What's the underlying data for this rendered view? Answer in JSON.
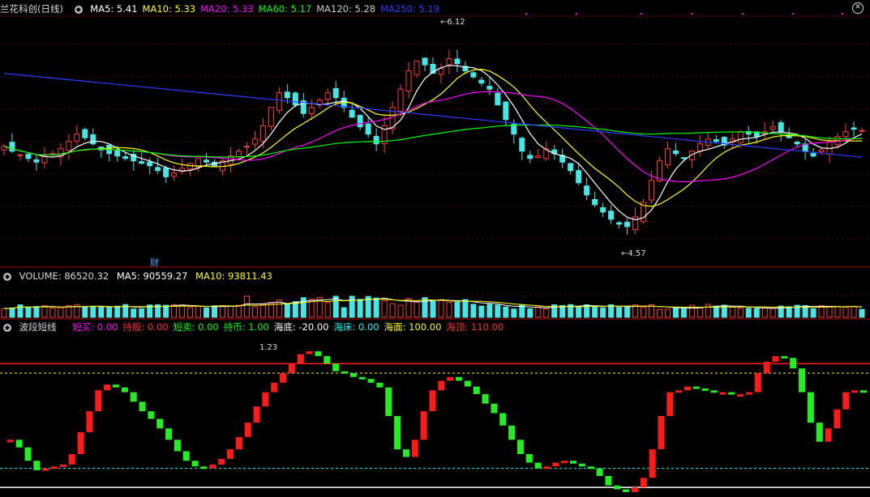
{
  "main_panel": {
    "title": "兰花科创(日线)",
    "ma": [
      {
        "label": "MA5: 5.41",
        "color": "#ffffff"
      },
      {
        "label": "MA10: 5.33",
        "color": "#ffff00"
      },
      {
        "label": "MA20: 5.33",
        "color": "#ff00ff"
      },
      {
        "label": "MA60: 5.17",
        "color": "#00ff00"
      },
      {
        "label": "MA120: 5.28",
        "color": "#cccccc"
      },
      {
        "label": "MA250: 5.19",
        "color": "#2a3cff"
      }
    ],
    "high_label": "6.12",
    "low_label": "4.57",
    "fin_mark": "财"
  },
  "volume_panel": {
    "title": "VOLUME: 86520.32",
    "ma5": "MA5: 90559.27",
    "ma10": "MA10: 93811.43"
  },
  "indicator_panel": {
    "title": "波段短线",
    "items": [
      {
        "label": "短买: 0.00",
        "color": "#ff00ff"
      },
      {
        "label": "持股: 0.00",
        "color": "#ff3030"
      },
      {
        "label": "短卖: 0.00",
        "color": "#00ff00"
      },
      {
        "label": "持币: 1.00",
        "color": "#00ff00"
      },
      {
        "label": "海底: -20.00",
        "color": "#ffffff"
      },
      {
        "label": "海床: 0.00",
        "color": "#00ffff"
      },
      {
        "label": "海面: 100.00",
        "color": "#ffff00"
      },
      {
        "label": "海顶: 110.00",
        "color": "#ff3030"
      }
    ],
    "peak_label": "1.23"
  },
  "chart_data": {
    "type": "candlestick",
    "price_range": [
      4.3,
      6.35
    ],
    "price_high": 6.12,
    "price_low": 4.57,
    "closes": [
      5.28,
      5.24,
      5.21,
      5.18,
      5.15,
      5.2,
      5.22,
      5.26,
      5.32,
      5.38,
      5.35,
      5.3,
      5.25,
      5.22,
      5.2,
      5.18,
      5.16,
      5.14,
      5.12,
      5.08,
      5.03,
      5.06,
      5.1,
      5.14,
      5.18,
      5.15,
      5.12,
      5.16,
      5.2,
      5.24,
      5.28,
      5.34,
      5.45,
      5.6,
      5.72,
      5.68,
      5.62,
      5.55,
      5.6,
      5.66,
      5.72,
      5.68,
      5.6,
      5.52,
      5.44,
      5.38,
      5.3,
      5.45,
      5.6,
      5.75,
      5.9,
      5.98,
      5.95,
      5.88,
      5.92,
      6.0,
      5.96,
      5.9,
      5.85,
      5.8,
      5.75,
      5.62,
      5.5,
      5.38,
      5.24,
      5.18,
      5.2,
      5.26,
      5.22,
      5.15,
      5.08,
      4.98,
      4.88,
      4.8,
      4.74,
      4.68,
      4.64,
      4.62,
      4.7,
      4.82,
      5.0,
      5.16,
      5.26,
      5.22,
      5.18,
      5.24,
      5.3,
      5.34,
      5.32,
      5.29,
      5.34,
      5.4,
      5.38,
      5.36,
      5.4,
      5.44,
      5.4,
      5.35,
      5.3,
      5.24,
      5.2,
      5.25,
      5.32,
      5.36,
      5.4,
      5.42,
      5.41
    ],
    "volume_range": [
      0,
      360000
    ],
    "signal_range": [
      -25,
      140
    ],
    "signal_levels": {
      "haidi": -20,
      "haichuang": 0,
      "haimian": 100,
      "haiding": 110
    },
    "signal": [
      28,
      30,
      22,
      8,
      -2,
      0,
      2,
      4,
      15,
      38,
      60,
      82,
      88,
      85,
      80,
      70,
      60,
      52,
      42,
      30,
      18,
      8,
      2,
      0,
      4,
      10,
      20,
      33,
      48,
      65,
      80,
      90,
      100,
      110,
      120,
      123,
      118,
      110,
      102,
      100,
      96,
      94,
      90,
      85,
      55,
      20,
      12,
      30,
      60,
      82,
      92,
      96,
      92,
      86,
      78,
      68,
      58,
      45,
      30,
      15,
      6,
      0,
      2,
      6,
      8,
      5,
      2,
      0,
      -8,
      -18,
      -22,
      -25,
      -20,
      -10,
      20,
      55,
      80,
      82,
      86,
      84,
      82,
      80,
      80,
      78,
      78,
      80,
      100,
      112,
      118,
      116,
      105,
      80,
      48,
      28,
      42,
      62,
      80,
      82,
      80
    ]
  }
}
